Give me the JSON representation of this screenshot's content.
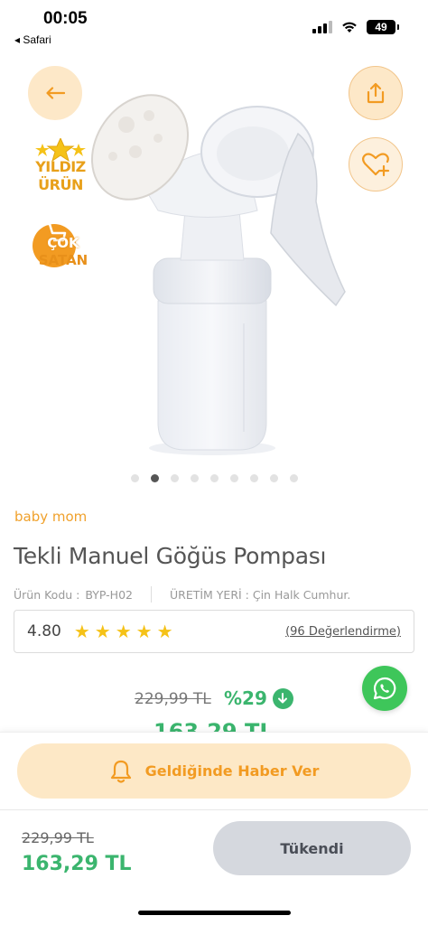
{
  "status_bar": {
    "time": "00:05",
    "back_app": "◂ Safari",
    "battery": "49"
  },
  "product_image": {
    "badges": {
      "star_product": [
        "YILDIZ",
        "ÜRÜN"
      ],
      "best_seller": [
        "ÇOK",
        "SATAN"
      ]
    },
    "carousel": {
      "total": 9,
      "active_index": 1
    }
  },
  "product": {
    "brand": "baby mom",
    "title": "Tekli Manuel Göğüs Pompası",
    "code_label": "Ürün Kodu :",
    "code_value": "BYP-H02",
    "origin": "ÜRETİM YERİ : Çin Halk Cumhur.",
    "rating": "4.80",
    "stars": 5,
    "reviews": "(96 Değerlendirme)"
  },
  "pricing": {
    "old_price": "229,99 TL",
    "discount": "%29",
    "new_price": "163,29 TL"
  },
  "notify": {
    "label": "Geldiğinde Haber Ver"
  },
  "bottom_bar": {
    "old_price": "229,99 TL",
    "new_price": "163,29 TL",
    "sold_out_label": "Tükendi"
  },
  "colors": {
    "accent_orange": "#f29b22",
    "price_green": "#3bb56e",
    "button_peach": "#fde8c6",
    "whatsapp_green": "#3ec65a",
    "disabled_gray": "#d5d8de"
  },
  "icons": [
    "back-arrow-icon",
    "share-icon",
    "heart-plus-icon",
    "bell-icon",
    "whatsapp-icon",
    "down-arrow-icon",
    "star-icon"
  ]
}
